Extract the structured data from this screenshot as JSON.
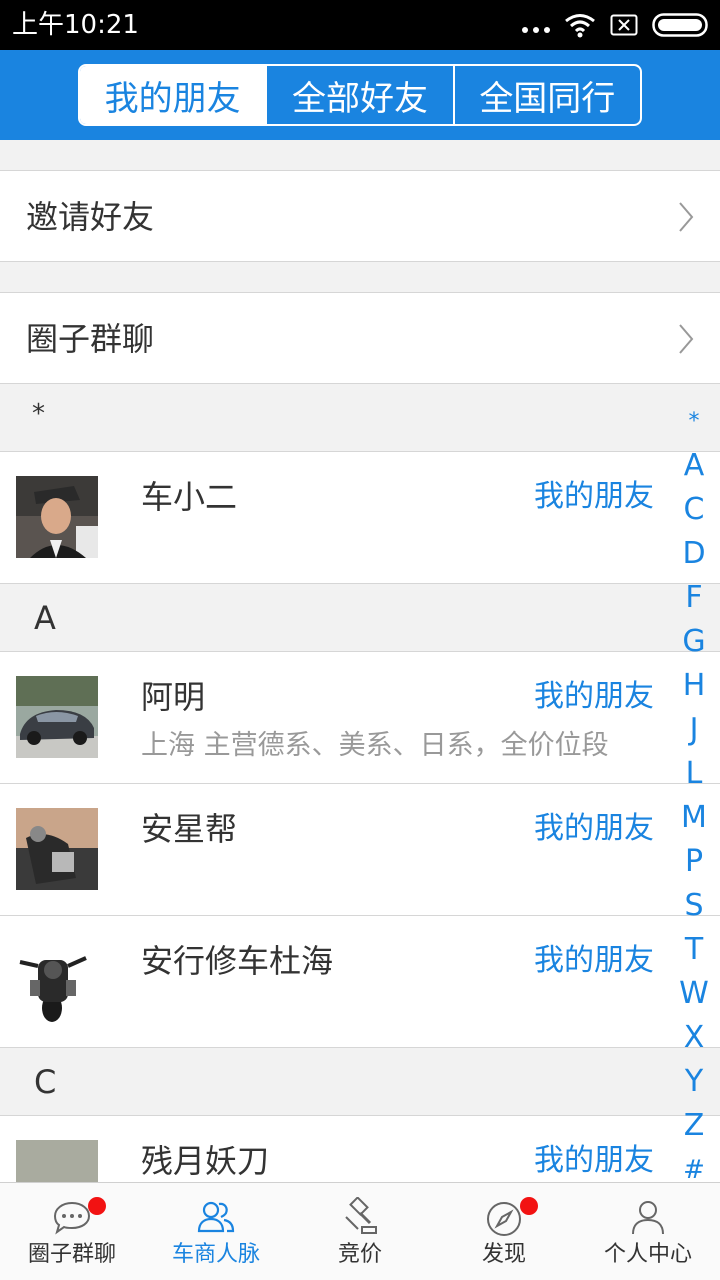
{
  "status_bar": {
    "time": "上午10:21"
  },
  "header": {
    "tabs": [
      {
        "label": "我的朋友",
        "active": true
      },
      {
        "label": "全部好友",
        "active": false
      },
      {
        "label": "全国同行",
        "active": false
      }
    ]
  },
  "menu": {
    "invite_label": "邀请好友",
    "group_chat_label": "圈子群聊"
  },
  "sections": {
    "star": "*",
    "a": "A",
    "c": "C"
  },
  "contacts": [
    {
      "name": "车小二",
      "tag": "我的朋友",
      "description": ""
    },
    {
      "name": "阿明",
      "tag": "我的朋友",
      "description": "上海  主营德系、美系、日系，全价位段"
    },
    {
      "name": "安星帮",
      "tag": "我的朋友",
      "description": ""
    },
    {
      "name": "安行修车杜海",
      "tag": "我的朋友",
      "description": ""
    },
    {
      "name": "残月妖刀",
      "tag": "我的朋友",
      "description": ""
    }
  ],
  "index_letters": [
    "*",
    "A",
    "C",
    "D",
    "F",
    "G",
    "H",
    "J",
    "L",
    "M",
    "P",
    "S",
    "T",
    "W",
    "X",
    "Y",
    "Z",
    "#"
  ],
  "bottom_nav": [
    {
      "label": "圈子群聊",
      "icon": "chat-bubble-icon",
      "badge": true,
      "active": false
    },
    {
      "label": "车商人脉",
      "icon": "people-icon",
      "badge": false,
      "active": true
    },
    {
      "label": "竞价",
      "icon": "gavel-icon",
      "badge": false,
      "active": false
    },
    {
      "label": "发现",
      "icon": "compass-icon",
      "badge": true,
      "active": false
    },
    {
      "label": "个人中心",
      "icon": "person-icon",
      "badge": false,
      "active": false
    }
  ],
  "colors": {
    "accent": "#1a84e0",
    "badge": "#f21212"
  }
}
